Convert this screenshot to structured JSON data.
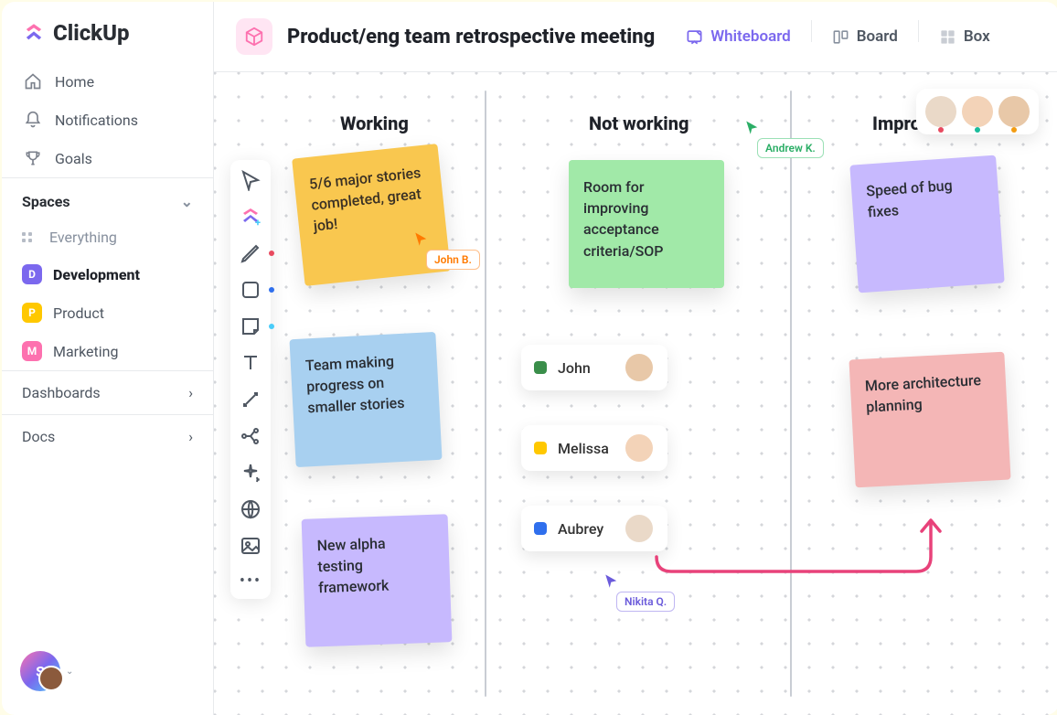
{
  "brand": "ClickUp",
  "nav": {
    "home": "Home",
    "notifications": "Notifications",
    "goals": "Goals"
  },
  "spaces": {
    "header": "Spaces",
    "everything": "Everything",
    "items": [
      {
        "letter": "D",
        "label": "Development",
        "color": "#7B68EE",
        "active": true
      },
      {
        "letter": "P",
        "label": "Product",
        "color": "#FFC800",
        "active": false
      },
      {
        "letter": "M",
        "label": "Marketing",
        "color": "#FD71AF",
        "active": false
      }
    ]
  },
  "sections": {
    "dashboards": "Dashboards",
    "docs": "Docs"
  },
  "user_avatar_letter": "S",
  "page": {
    "title": "Product/eng team retrospective meeting"
  },
  "views": {
    "whiteboard": "Whiteboard",
    "board": "Board",
    "box": "Box"
  },
  "columns": {
    "working": "Working",
    "not_working": "Not working",
    "improve": "Improve"
  },
  "stickies": {
    "s1": "5/6 major stories completed, great job!",
    "s2": "Team making progress on smaller stories",
    "s3": "New alpha testing framework",
    "s4": "Room for improving acceptance criteria/SOP",
    "s5": "Speed of bug fixes",
    "s6": "More architecture planning"
  },
  "cursors": {
    "john": "John B.",
    "andrew": "Andrew K.",
    "nikita": "Nikita Q."
  },
  "people_chips": [
    {
      "name": "John",
      "color": "#3A8E4A"
    },
    {
      "name": "Melissa",
      "color": "#FFC800"
    },
    {
      "name": "Aubrey",
      "color": "#2F6FED"
    }
  ],
  "presence_dots": [
    "#E84A5F",
    "#1ABC9C",
    "#F39C12"
  ],
  "colors": {
    "primary": "#7B68EE",
    "pink": "#FD71AF",
    "green_cursor": "#2BAE66",
    "orange_cursor": "#FF7A00",
    "purple_cursor": "#6B5BDB",
    "arrow": "#E8427A"
  }
}
